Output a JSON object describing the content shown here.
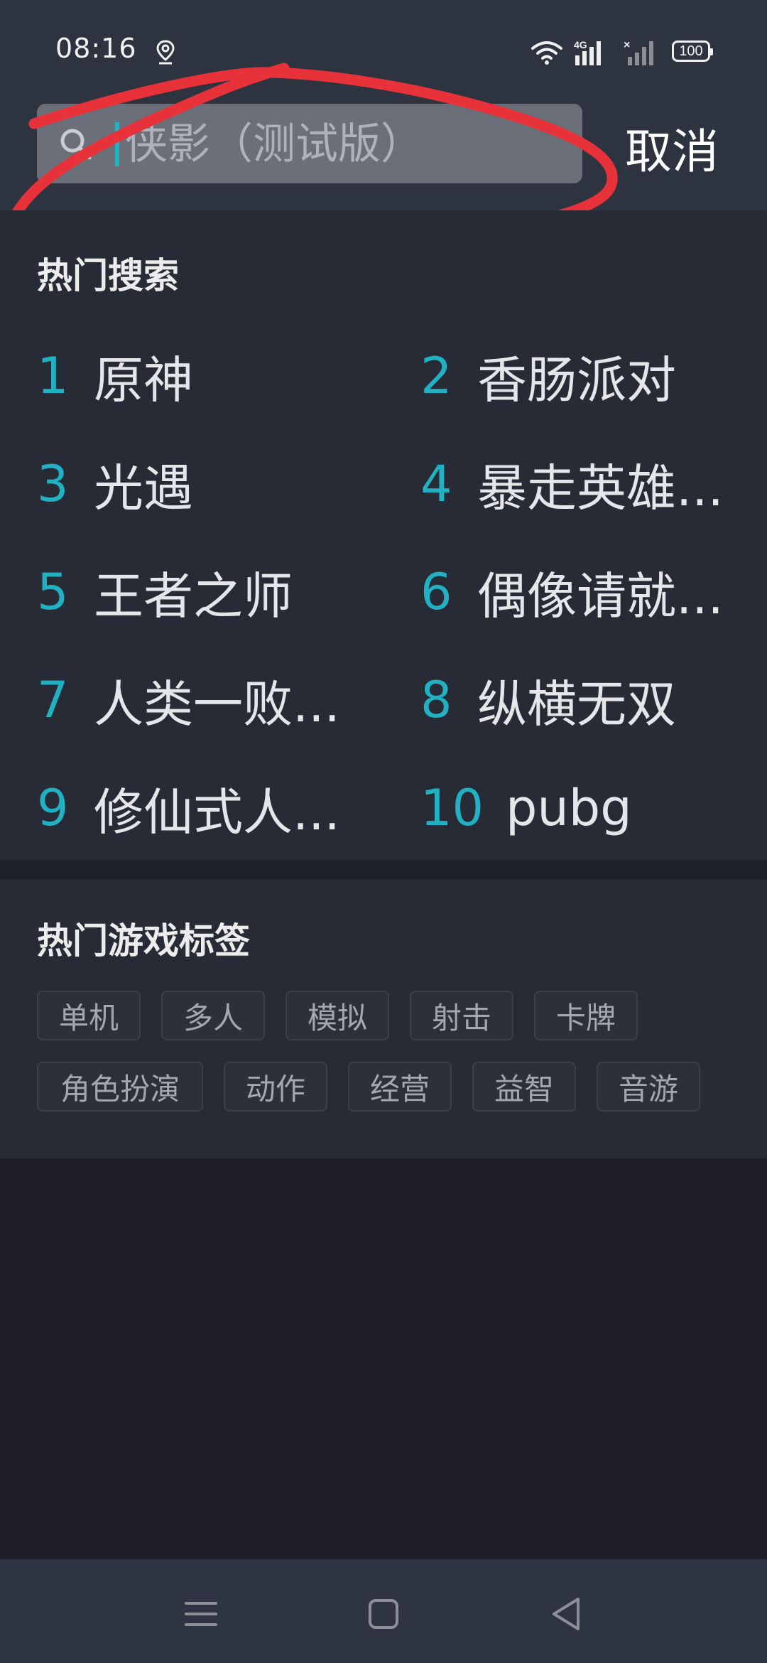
{
  "status_bar": {
    "time": "08:16",
    "network_label": "4G",
    "battery": "100",
    "icons": [
      "location-icon",
      "wifi-icon",
      "signal-icon",
      "no-signal-icon",
      "battery-icon"
    ]
  },
  "search": {
    "placeholder": "侠影（测试版）",
    "value": "",
    "cancel_label": "取消"
  },
  "hot_search": {
    "title": "热门搜索",
    "items": [
      {
        "rank": "1",
        "label": "原神"
      },
      {
        "rank": "2",
        "label": "香肠派对"
      },
      {
        "rank": "3",
        "label": "光遇"
      },
      {
        "rank": "4",
        "label": "暴走英雄..."
      },
      {
        "rank": "5",
        "label": "王者之师"
      },
      {
        "rank": "6",
        "label": "偶像请就..."
      },
      {
        "rank": "7",
        "label": "人类一败..."
      },
      {
        "rank": "8",
        "label": "纵横无双"
      },
      {
        "rank": "9",
        "label": "修仙式人..."
      },
      {
        "rank": "10",
        "label": "pubg"
      }
    ]
  },
  "hot_tags": {
    "title": "热门游戏标签",
    "tags": [
      "单机",
      "多人",
      "模拟",
      "射击",
      "卡牌",
      "角色扮演",
      "动作",
      "经营",
      "益智",
      "音游"
    ]
  },
  "colors": {
    "accent": "#22b1c2",
    "annotation": "#e8323a"
  },
  "nav_bar": {
    "icons": [
      "menu-icon",
      "home-icon",
      "back-icon"
    ]
  }
}
